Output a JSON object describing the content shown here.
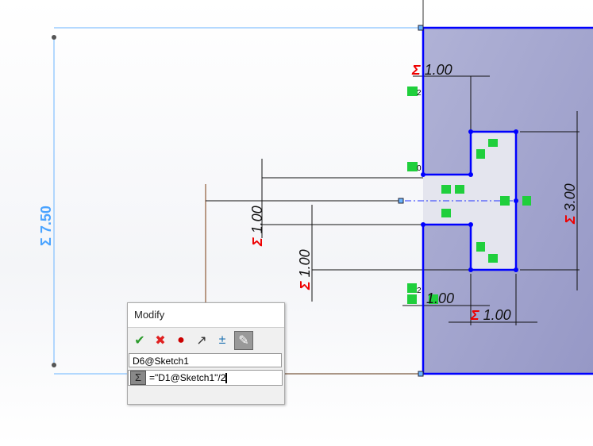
{
  "sketch": {
    "dimensions": [
      {
        "id": "overall_height",
        "label": "7.50",
        "color": "#4aa3ff"
      },
      {
        "id": "top_width",
        "label": "1.00"
      },
      {
        "id": "slot_left_1",
        "label": "1.00"
      },
      {
        "id": "slot_left_2",
        "label": "1.00"
      },
      {
        "id": "tee_height",
        "label": "3.00"
      },
      {
        "id": "bottom_width",
        "label": "1.00"
      },
      {
        "id": "bottom_left",
        "label": "1.00"
      }
    ],
    "sigma": "Σ",
    "relation_subscripts": [
      "2",
      "0",
      "2"
    ],
    "colors": {
      "sketch_line": "#0000ff",
      "face": "#a3a6cf",
      "relation": "#1fcf3c",
      "driven_sigma": "#e00000"
    }
  },
  "modify_dialog": {
    "title": "Modify",
    "tools": [
      {
        "name": "ok",
        "glyph": "✔"
      },
      {
        "name": "cancel",
        "glyph": "✖"
      },
      {
        "name": "rebuild",
        "glyph": "●"
      },
      {
        "name": "reverse",
        "glyph": "↗"
      },
      {
        "name": "spin-increment",
        "glyph": "±"
      },
      {
        "name": "mark-for-drawing",
        "glyph": "✎"
      }
    ],
    "dimension_name": "D6@Sketch1",
    "equation_icon": "Σ",
    "equation_value": "=\"D1@Sketch1\"/2"
  }
}
